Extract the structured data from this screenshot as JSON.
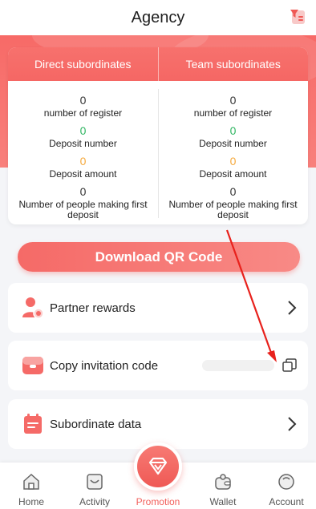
{
  "header": {
    "title": "Agency"
  },
  "stats": {
    "direct": {
      "title": "Direct subordinates",
      "register_value": "0",
      "register_label": "number of register",
      "deposit_num_value": "0",
      "deposit_num_label": "Deposit number",
      "deposit_amt_value": "0",
      "deposit_amt_label": "Deposit amount",
      "first_dep_value": "0",
      "first_dep_label": "Number of people making first deposit"
    },
    "team": {
      "title": "Team subordinates",
      "register_value": "0",
      "register_label": "number of register",
      "deposit_num_value": "0",
      "deposit_num_label": "Deposit number",
      "deposit_amt_value": "0",
      "deposit_amt_label": "Deposit amount",
      "first_dep_value": "0",
      "first_dep_label": "Number of people making first deposit"
    }
  },
  "download_button": "Download QR Code",
  "menu": {
    "partner_rewards": "Partner rewards",
    "copy_invitation": "Copy invitation code",
    "subordinate_data": "Subordinate data"
  },
  "tabs": {
    "home": "Home",
    "activity": "Activity",
    "promotion": "Promotion",
    "wallet": "Wallet",
    "account": "Account"
  },
  "colors": {
    "accent": "#f56a67",
    "green": "#2fb561",
    "orange": "#f5a93c"
  }
}
